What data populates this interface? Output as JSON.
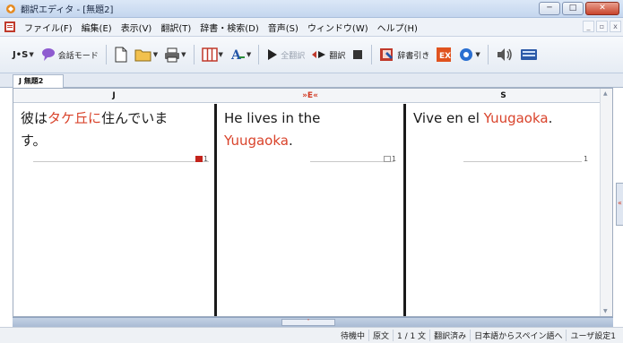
{
  "window": {
    "title": "翻訳エディタ - [無題2]",
    "minimize": "─",
    "maximize": "□",
    "close": "✕"
  },
  "menu": {
    "items": [
      "ファイル(F)",
      "編集(E)",
      "表示(V)",
      "翻訳(T)",
      "辞書・検索(D)",
      "音声(S)",
      "ウィンドウ(W)",
      "ヘルプ(H)"
    ],
    "mdi_min": "_",
    "mdi_restore": "▫",
    "mdi_close": "x"
  },
  "toolbar": {
    "lang_switch": "J•S",
    "conversation_mode": "会話モード",
    "translate_all": "全翻訳",
    "translate": "翻訳",
    "dictionary": "辞書引き"
  },
  "tab": {
    "label": "J 無題2"
  },
  "columns": {
    "j": {
      "header": "J"
    },
    "e": {
      "header": "»E«"
    },
    "s": {
      "header": "S"
    }
  },
  "segments": {
    "j": {
      "pre": "彼は",
      "hl": "タケ丘に",
      "post": "住んでいま",
      "line2": "す。",
      "mark": "1"
    },
    "e": {
      "line1": "He lives in the",
      "hl": "Yuugaoka",
      "post": ".",
      "mark": "1"
    },
    "s": {
      "pre": "Vive en el ",
      "hl": "Yuugaoka",
      "post": ".",
      "mark": "1"
    }
  },
  "statusbar": {
    "state": "待機中",
    "source": "原文",
    "position": "1 / 1 文",
    "translated": "翻訳済み",
    "direction": "日本語からスペイン語へ",
    "user_settings": "ユーザ設定1"
  },
  "colors": {
    "highlight": "#d9432b",
    "accent": "#d23a23"
  }
}
